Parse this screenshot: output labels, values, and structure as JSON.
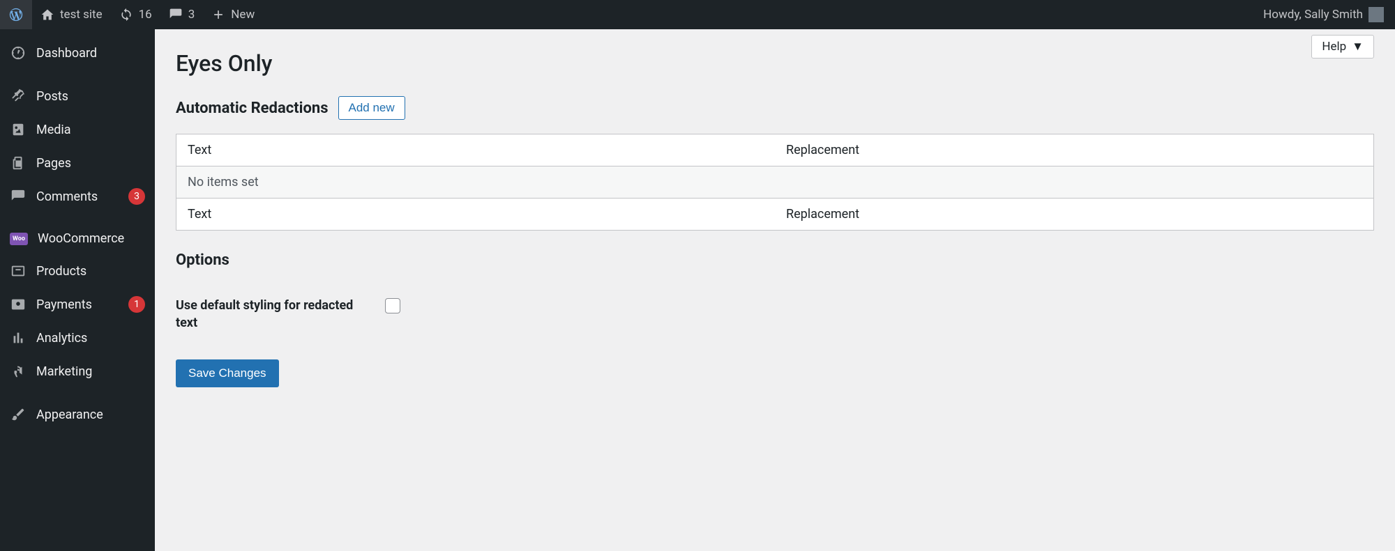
{
  "adminbar": {
    "site_name": "test site",
    "updates_count": "16",
    "comments_count": "3",
    "new_label": "New",
    "howdy_prefix": "Howdy, ",
    "user_name": "Sally Smith"
  },
  "sidebar": {
    "items": [
      {
        "label": "Dashboard",
        "icon": "dashboard"
      },
      {
        "label": "Posts",
        "icon": "pin"
      },
      {
        "label": "Media",
        "icon": "media"
      },
      {
        "label": "Pages",
        "icon": "pages"
      },
      {
        "label": "Comments",
        "icon": "comment",
        "badge": "3"
      },
      {
        "label": "WooCommerce",
        "icon": "woo"
      },
      {
        "label": "Products",
        "icon": "products"
      },
      {
        "label": "Payments",
        "icon": "payments",
        "badge": "1"
      },
      {
        "label": "Analytics",
        "icon": "analytics"
      },
      {
        "label": "Marketing",
        "icon": "marketing"
      },
      {
        "label": "Appearance",
        "icon": "appearance"
      }
    ]
  },
  "content": {
    "help_label": "Help",
    "page_title": "Eyes Only",
    "section_title": "Automatic Redactions",
    "add_new_label": "Add new",
    "table": {
      "col_text": "Text",
      "col_replacement": "Replacement",
      "empty_row": "No items set"
    },
    "options_title": "Options",
    "option_default_styling": "Use default styling for redacted text",
    "save_label": "Save Changes"
  }
}
